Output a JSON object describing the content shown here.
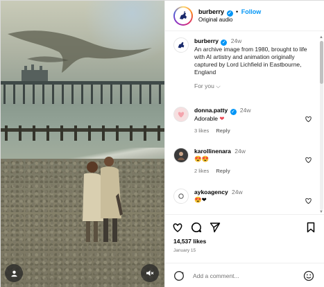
{
  "post": {
    "account": "burberry",
    "follow_label": "Follow",
    "separator": "•",
    "audio": "Original audio"
  },
  "caption": {
    "username": "burberry",
    "age": "24w",
    "text": "An archive image from 1980, brought to life with AI artistry and animation originally captured by Lord Lichfield in Eastbourne, England",
    "for_you_label": "For you",
    "for_you_chevron": "⌵"
  },
  "comments": [
    {
      "username": "donna.patty",
      "verified": true,
      "age": "24w",
      "text": "Adorable",
      "emoji": "❤",
      "likes": "3 likes",
      "reply": "Reply",
      "avatar_icon": "heart-avatar-icon"
    },
    {
      "username": "karollinenara",
      "verified": false,
      "age": "24w",
      "text": "",
      "emoji": "😍😍",
      "likes": "2 likes",
      "reply": "Reply",
      "avatar_icon": "user-photo-avatar"
    },
    {
      "username": "aykoagency",
      "verified": false,
      "age": "24w",
      "text": "",
      "emoji": "😍❤",
      "likes": "",
      "reply": "",
      "avatar_icon": "agency-logo-avatar"
    }
  ],
  "engagement": {
    "likes": "14,537 likes",
    "date": "January 15"
  },
  "composer": {
    "placeholder": "Add a comment..."
  },
  "colors": {
    "link_blue": "#0095f6",
    "muted_text": "#737373",
    "heart_red": "#ed4956"
  },
  "icons": {
    "like": "heart-outline-icon",
    "comment": "speech-bubble-icon",
    "share": "paper-plane-icon",
    "save": "bookmark-icon",
    "tag": "user-tag-icon",
    "mute": "speaker-muted-icon",
    "emoji": "smiley-icon",
    "brand": "burberry-knight-logo"
  }
}
